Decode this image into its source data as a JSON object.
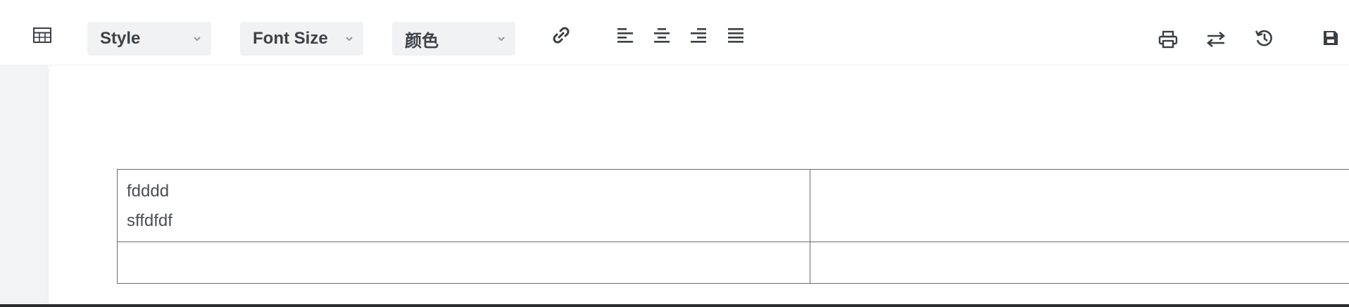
{
  "toolbar": {
    "table_icon": "table-icon",
    "style_dropdown": {
      "label": "Style"
    },
    "font_size_dropdown": {
      "label": "Font Size"
    },
    "color_dropdown": {
      "label": "颜色"
    },
    "link_icon": "link-icon",
    "align_left_icon": "align-left-icon",
    "align_center_icon": "align-center-icon",
    "align_right_icon": "align-right-icon",
    "align_justify_icon": "align-justify-icon",
    "print_icon": "print-icon",
    "swap_icon": "swap-icon",
    "history_icon": "history-icon",
    "save_icon": "save-icon"
  },
  "document": {
    "table": {
      "rows": [
        {
          "cells": [
            {
              "lines": [
                "fdddd",
                "sffdfdf"
              ]
            },
            {
              "lines": []
            }
          ]
        },
        {
          "cells": [
            {
              "lines": []
            },
            {
              "lines": []
            }
          ]
        }
      ]
    }
  },
  "colors": {
    "toolbar_bg": "#ffffff",
    "dropdown_bg": "#f1f2f4",
    "gutter_bg": "#f2f3f5",
    "icon": "#3a3f45",
    "table_border": "#6a6d70",
    "text": "#4a4f55"
  }
}
